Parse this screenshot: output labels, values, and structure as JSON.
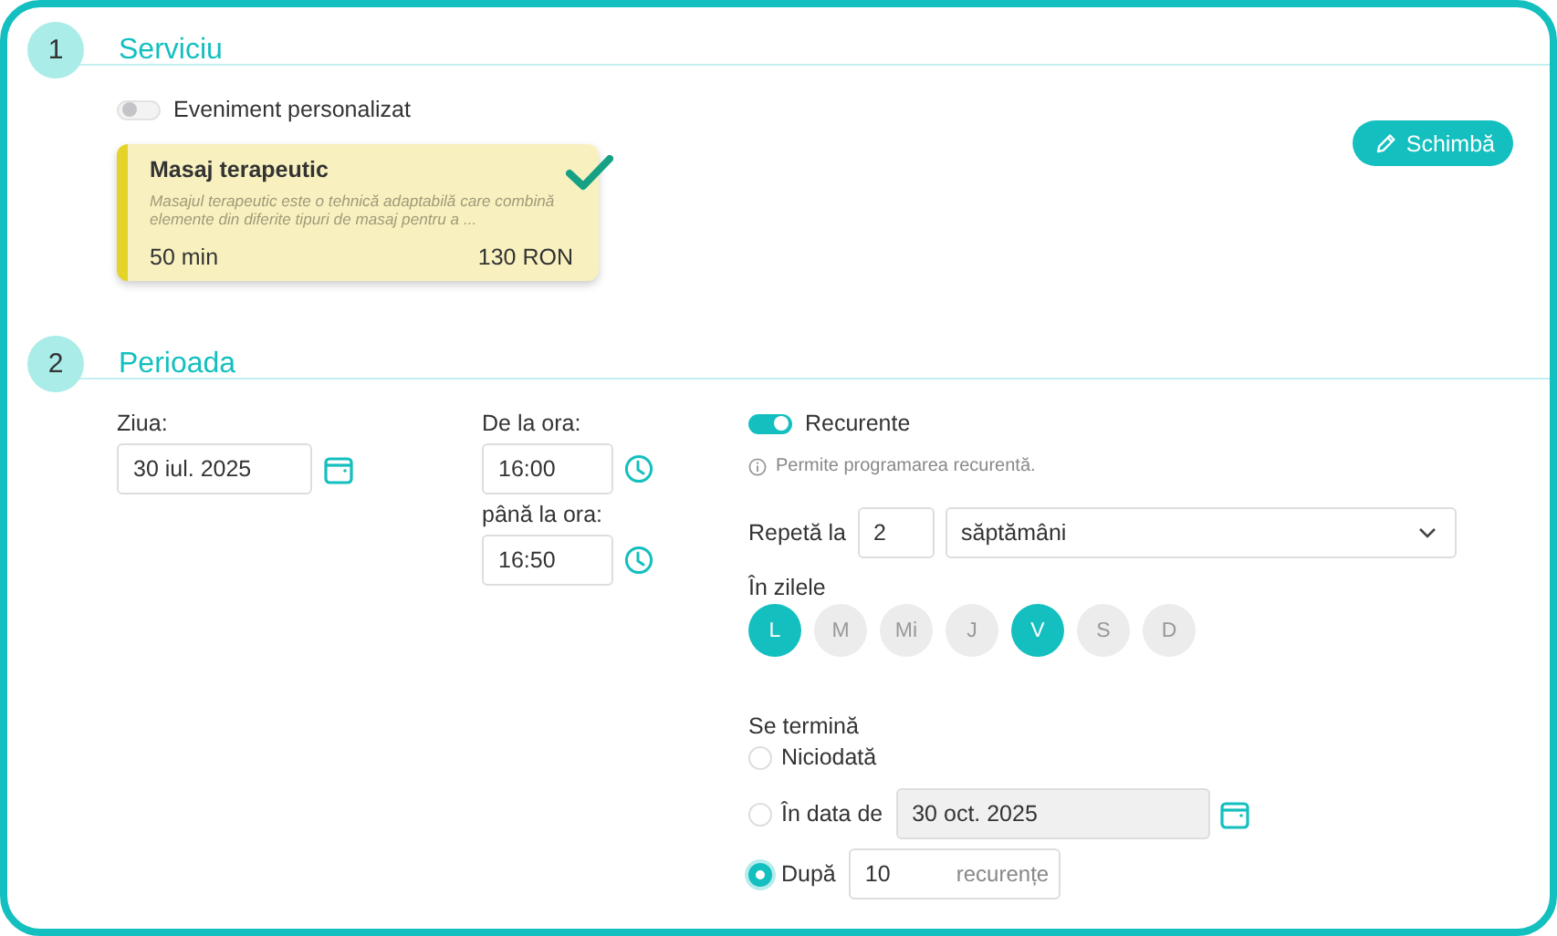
{
  "service": {
    "number": "1",
    "title": "Serviciu",
    "custom_event": {
      "label": "Eveniment personalizat",
      "on": false
    },
    "card": {
      "name": "Masaj terapeutic",
      "description": "Masajul terapeutic este o tehnică adaptabilă care combină elemente din diferite tipuri de masaj pentru a ...",
      "duration": "50 min",
      "price": "130 RON",
      "selected": true
    },
    "change_button": "Schimbă"
  },
  "period": {
    "number": "2",
    "title": "Perioada",
    "day": {
      "label": "Ziua:",
      "value": "30 iul. 2025"
    },
    "from": {
      "label": "De la ora:",
      "value": "16:00"
    },
    "to": {
      "label": "până la ora:",
      "value": "16:50"
    },
    "recurring": {
      "label": "Recurente",
      "on": true,
      "hint": "Permite programarea recurentă."
    },
    "repeat": {
      "label": "Repetă la",
      "value": "2",
      "unit": "săptămâni"
    },
    "days_label": "În zilele",
    "days": [
      {
        "label": "L",
        "selected": true
      },
      {
        "label": "M",
        "selected": false
      },
      {
        "label": "Mi",
        "selected": false
      },
      {
        "label": "J",
        "selected": false
      },
      {
        "label": "V",
        "selected": true
      },
      {
        "label": "S",
        "selected": false
      },
      {
        "label": "D",
        "selected": false
      }
    ],
    "ends_label": "Se termină",
    "end_options": [
      {
        "kind": "never",
        "label": "Niciodată",
        "selected": false
      },
      {
        "kind": "date",
        "label": "În data de",
        "value": "30 oct. 2025",
        "selected": false
      },
      {
        "kind": "count",
        "label": "După",
        "value": "10",
        "suffix": "recurențe",
        "selected": true
      }
    ]
  }
}
